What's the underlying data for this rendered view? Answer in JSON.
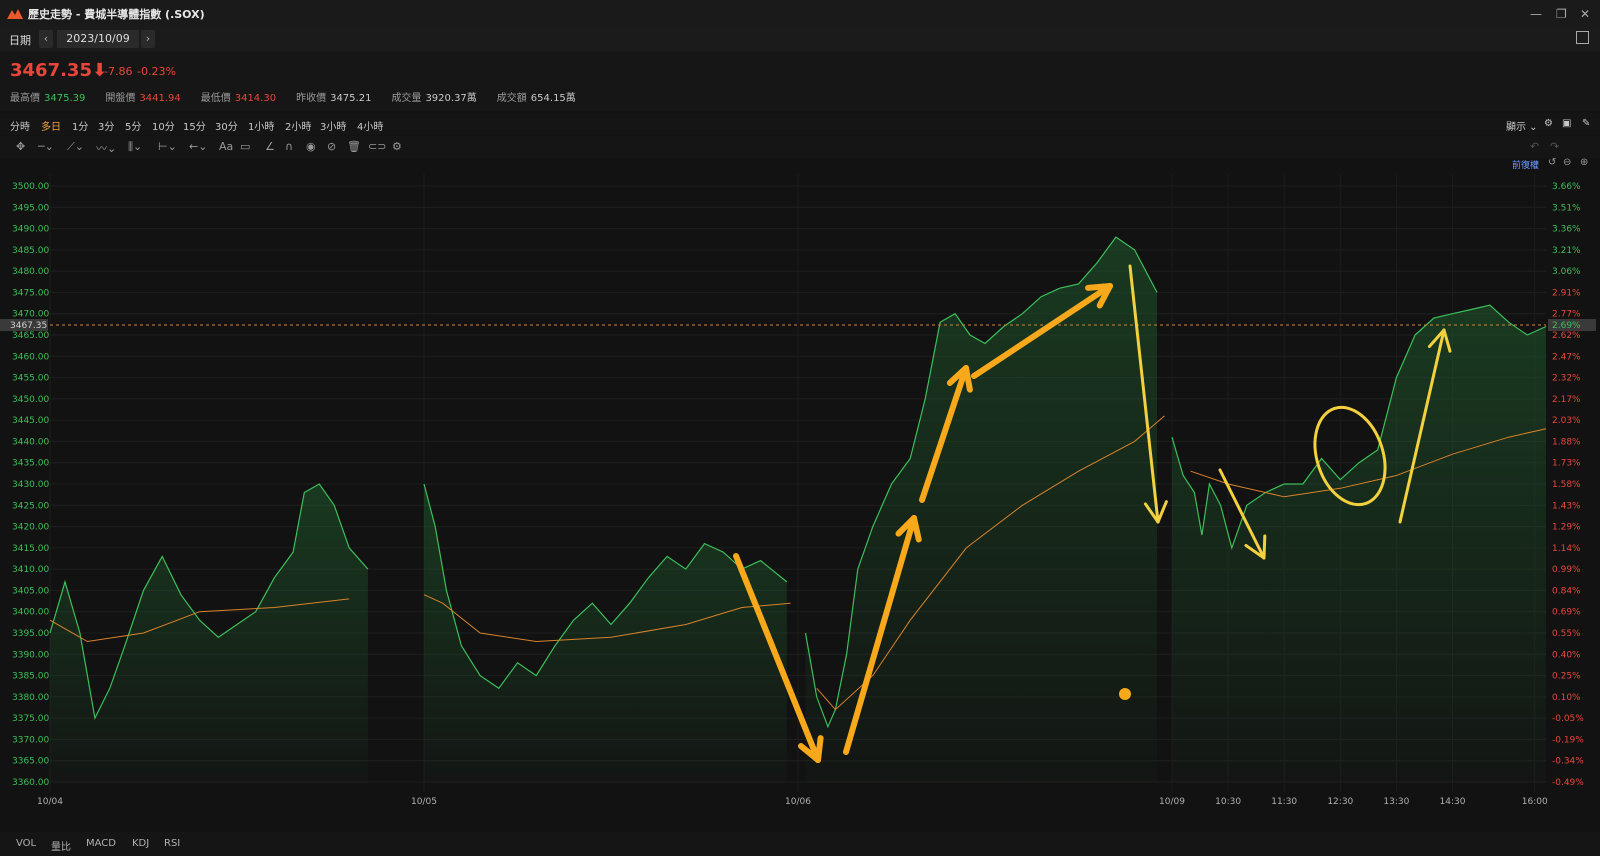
{
  "window": {
    "title": "歷史走勢 - 費城半導體指數 (.SOX)"
  },
  "datebar": {
    "label": "日期",
    "date": "2023/10/09",
    "prev": "‹",
    "next": "›"
  },
  "quote": {
    "price": "3467.35",
    "arrow": "⬇",
    "change": "-7.86",
    "change_pct": "-0.23%",
    "stats": [
      {
        "label": "最高價",
        "value": "3475.39",
        "color": "g"
      },
      {
        "label": "開盤價",
        "value": "3441.94",
        "color": "r"
      },
      {
        "label": "最低價",
        "value": "3414.30",
        "color": "r"
      },
      {
        "label": "昨收價",
        "value": "3475.21",
        "color": "w"
      },
      {
        "label": "成交量",
        "value": "3920.37萬",
        "color": "w"
      },
      {
        "label": "成交額",
        "value": "654.15萬",
        "color": "w"
      }
    ]
  },
  "timeframes": [
    "分時",
    "多日",
    "1分",
    "3分",
    "5分",
    "10分",
    "15分",
    "30分",
    "1小時",
    "2小時",
    "3小時",
    "4小時"
  ],
  "active_timeframe": "多日",
  "toolbar_right": {
    "display": "顯示 ⌄",
    "adjust": "前復權"
  },
  "chart_data": {
    "type": "line",
    "y_left_ticks": [
      "3500.00",
      "3495.00",
      "3490.00",
      "3485.00",
      "3480.00",
      "3475.00",
      "3470.00",
      "3465.00",
      "3460.00",
      "3455.00",
      "3450.00",
      "3445.00",
      "3440.00",
      "3435.00",
      "3430.00",
      "3425.00",
      "3420.00",
      "3415.00",
      "3410.00",
      "3405.00",
      "3400.00",
      "3395.00",
      "3390.00",
      "3385.00",
      "3380.00",
      "3375.00",
      "3370.00",
      "3365.00",
      "3360.00"
    ],
    "y_right_ticks": [
      "3.66%",
      "3.51%",
      "3.36%",
      "3.21%",
      "3.06%",
      "2.91%",
      "2.77%",
      "2.62%",
      "2.47%",
      "2.32%",
      "2.17%",
      "2.03%",
      "1.88%",
      "1.73%",
      "1.58%",
      "1.43%",
      "1.29%",
      "1.14%",
      "0.99%",
      "0.84%",
      "0.69%",
      "0.55%",
      "0.40%",
      "0.25%",
      "0.10%",
      "-0.05%",
      "-0.19%",
      "-0.34%",
      "-0.49%"
    ],
    "ylim": [
      3360,
      3500
    ],
    "x_tick_labels": [
      {
        "x": 0,
        "label": "10/04"
      },
      {
        "x": 1,
        "label": "10/05"
      },
      {
        "x": 2,
        "label": "10/06"
      },
      {
        "x": 3,
        "label": "10/09"
      },
      {
        "x": 3.15,
        "label": "10:30"
      },
      {
        "x": 3.3,
        "label": "11:30"
      },
      {
        "x": 3.45,
        "label": "12:30"
      },
      {
        "x": 3.6,
        "label": "13:30"
      },
      {
        "x": 3.75,
        "label": "14:30"
      },
      {
        "x": 3.97,
        "label": "16:00"
      }
    ],
    "xlim": [
      0,
      4
    ],
    "current_price": {
      "value": 3467.35,
      "label": "3467.35",
      "pct_label": "2.69%"
    },
    "series": [
      {
        "values": [
          [
            0,
            3395
          ],
          [
            0.04,
            3407
          ],
          [
            0.08,
            3395
          ],
          [
            0.12,
            3375
          ],
          [
            0.16,
            3382
          ],
          [
            0.2,
            3392
          ],
          [
            0.25,
            3405
          ],
          [
            0.3,
            3413
          ],
          [
            0.35,
            3404
          ],
          [
            0.4,
            3398
          ],
          [
            0.45,
            3394
          ],
          [
            0.5,
            3397
          ],
          [
            0.55,
            3400
          ],
          [
            0.6,
            3408
          ],
          [
            0.65,
            3414
          ],
          [
            0.68,
            3428
          ],
          [
            0.72,
            3430
          ],
          [
            0.76,
            3425
          ],
          [
            0.8,
            3415
          ],
          [
            0.85,
            3410
          ],
          [
            1,
            3430
          ],
          [
            1.03,
            3420
          ],
          [
            1.06,
            3405
          ],
          [
            1.1,
            3392
          ],
          [
            1.15,
            3385
          ],
          [
            1.2,
            3382
          ],
          [
            1.25,
            3388
          ],
          [
            1.3,
            3385
          ],
          [
            1.35,
            3392
          ],
          [
            1.4,
            3398
          ],
          [
            1.45,
            3402
          ],
          [
            1.5,
            3397
          ],
          [
            1.55,
            3402
          ],
          [
            1.6,
            3408
          ],
          [
            1.65,
            3413
          ],
          [
            1.7,
            3410
          ],
          [
            1.75,
            3416
          ],
          [
            1.8,
            3414
          ],
          [
            1.85,
            3410
          ],
          [
            1.9,
            3412
          ],
          [
            1.97,
            3407
          ],
          [
            2.02,
            3395
          ],
          [
            2.05,
            3380
          ],
          [
            2.08,
            3373
          ],
          [
            2.1,
            3377
          ],
          [
            2.13,
            3390
          ],
          [
            2.16,
            3410
          ],
          [
            2.2,
            3420
          ],
          [
            2.25,
            3430
          ],
          [
            2.3,
            3436
          ],
          [
            2.34,
            3450
          ],
          [
            2.38,
            3468
          ],
          [
            2.42,
            3470
          ],
          [
            2.46,
            3465
          ],
          [
            2.5,
            3463
          ],
          [
            2.55,
            3467
          ],
          [
            2.6,
            3470
          ],
          [
            2.65,
            3474
          ],
          [
            2.7,
            3476
          ],
          [
            2.75,
            3477
          ],
          [
            2.8,
            3482
          ],
          [
            2.85,
            3488
          ],
          [
            2.9,
            3485
          ],
          [
            2.96,
            3475
          ],
          [
            3,
            3441
          ],
          [
            3.03,
            3432
          ],
          [
            3.06,
            3428
          ],
          [
            3.08,
            3418
          ],
          [
            3.1,
            3430
          ],
          [
            3.13,
            3425
          ],
          [
            3.16,
            3415
          ],
          [
            3.2,
            3425
          ],
          [
            3.25,
            3428
          ],
          [
            3.3,
            3430
          ],
          [
            3.35,
            3430
          ],
          [
            3.4,
            3436
          ],
          [
            3.45,
            3431
          ],
          [
            3.5,
            3435
          ],
          [
            3.55,
            3438
          ],
          [
            3.6,
            3455
          ],
          [
            3.65,
            3465
          ],
          [
            3.7,
            3469
          ],
          [
            3.75,
            3470
          ],
          [
            3.8,
            3471
          ],
          [
            3.85,
            3472
          ],
          [
            3.9,
            3468
          ],
          [
            3.95,
            3465
          ],
          [
            4,
            3467
          ]
        ]
      },
      {
        "values": [
          [
            0,
            3398
          ],
          [
            0.1,
            3393
          ],
          [
            0.25,
            3395
          ],
          [
            0.4,
            3400
          ],
          [
            0.6,
            3401
          ],
          [
            0.8,
            3403
          ],
          [
            1.0,
            3404
          ],
          [
            1.05,
            3402
          ],
          [
            1.15,
            3395
          ],
          [
            1.3,
            3393
          ],
          [
            1.5,
            3394
          ],
          [
            1.7,
            3397
          ],
          [
            1.85,
            3401
          ],
          [
            1.98,
            3402
          ],
          [
            2.05,
            3382
          ],
          [
            2.1,
            3377
          ],
          [
            2.2,
            3385
          ],
          [
            2.3,
            3398
          ],
          [
            2.45,
            3415
          ],
          [
            2.6,
            3425
          ],
          [
            2.75,
            3433
          ],
          [
            2.9,
            3440
          ],
          [
            2.98,
            3446
          ],
          [
            3.05,
            3433
          ],
          [
            3.15,
            3430
          ],
          [
            3.3,
            3427
          ],
          [
            3.45,
            3429
          ],
          [
            3.6,
            3432
          ],
          [
            3.75,
            3437
          ],
          [
            3.9,
            3441
          ],
          [
            4,
            3443
          ]
        ]
      }
    ]
  },
  "bottom_tabs": [
    "VOL",
    "量比",
    "MACD",
    "KDJ",
    "RSI"
  ],
  "colors": {
    "up": "#3cbf5a",
    "down": "#e8463a",
    "ma": "#d9822b",
    "accent": "#f0a23a",
    "annotation_orange": "#f7a81b",
    "annotation_yellow": "#f3d03e"
  }
}
